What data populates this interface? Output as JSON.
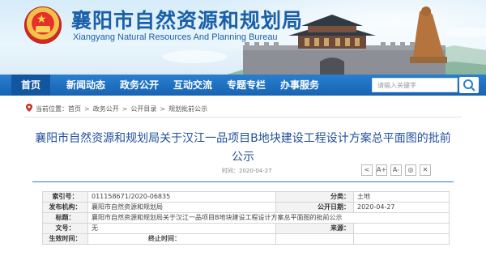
{
  "site": {
    "title": "襄阳市自然资源和规划局",
    "subtitle": "Xiangyang Natural Resources And Planning Bureau"
  },
  "nav": {
    "items": [
      {
        "label": "首页"
      },
      {
        "label": "新闻动态"
      },
      {
        "label": "政务公开"
      },
      {
        "label": "互动交流"
      },
      {
        "label": "专题专栏"
      },
      {
        "label": "办事服务"
      }
    ],
    "search_placeholder": "请输入关键字"
  },
  "breadcrumb": {
    "prefix": "当前位置：",
    "items": [
      "首页",
      "政务公开",
      "公开目录",
      "规划批前公示"
    ]
  },
  "article": {
    "title": "襄阳市自然资源和规划局关于汉江一品项目B地块建设工程设计方案总平面图的批前公示",
    "time_label": "时间：",
    "time": "2020-04-27"
  },
  "tools": [
    {
      "icon": "share-icon",
      "glyph": "<"
    },
    {
      "icon": "font-larger-icon",
      "glyph": "A+"
    },
    {
      "icon": "font-smaller-icon",
      "glyph": "A-"
    },
    {
      "icon": "wechat-icon",
      "glyph": "◎"
    },
    {
      "icon": "close-icon",
      "glyph": "✕"
    }
  ],
  "info": {
    "index_label": "索引号：",
    "index_value": "011158671/2020-06835",
    "category_label": "分类：",
    "category_value": "土地",
    "publisher_label": "发布机构：",
    "publisher_value": "襄阳市自然资源和规划局",
    "date_label": "公开日期：",
    "date_value": "2020-04-27",
    "title_label": "标题：",
    "title_value": "襄阳市自然资源和规划局关于汉江一品项目B地块建设工程设计方案总平面图的批前公示",
    "docno_label": "文号：",
    "docno_value": "无",
    "source_label": "来源：",
    "source_value": "",
    "effective_label": "生效时间：",
    "effective_value": "",
    "expire_label": "终止时间：",
    "expire_value": ""
  },
  "colors": {
    "nav_bg": "#1763b3",
    "title_blue": "#1a5fa8",
    "article_title": "#1f4f9c"
  }
}
